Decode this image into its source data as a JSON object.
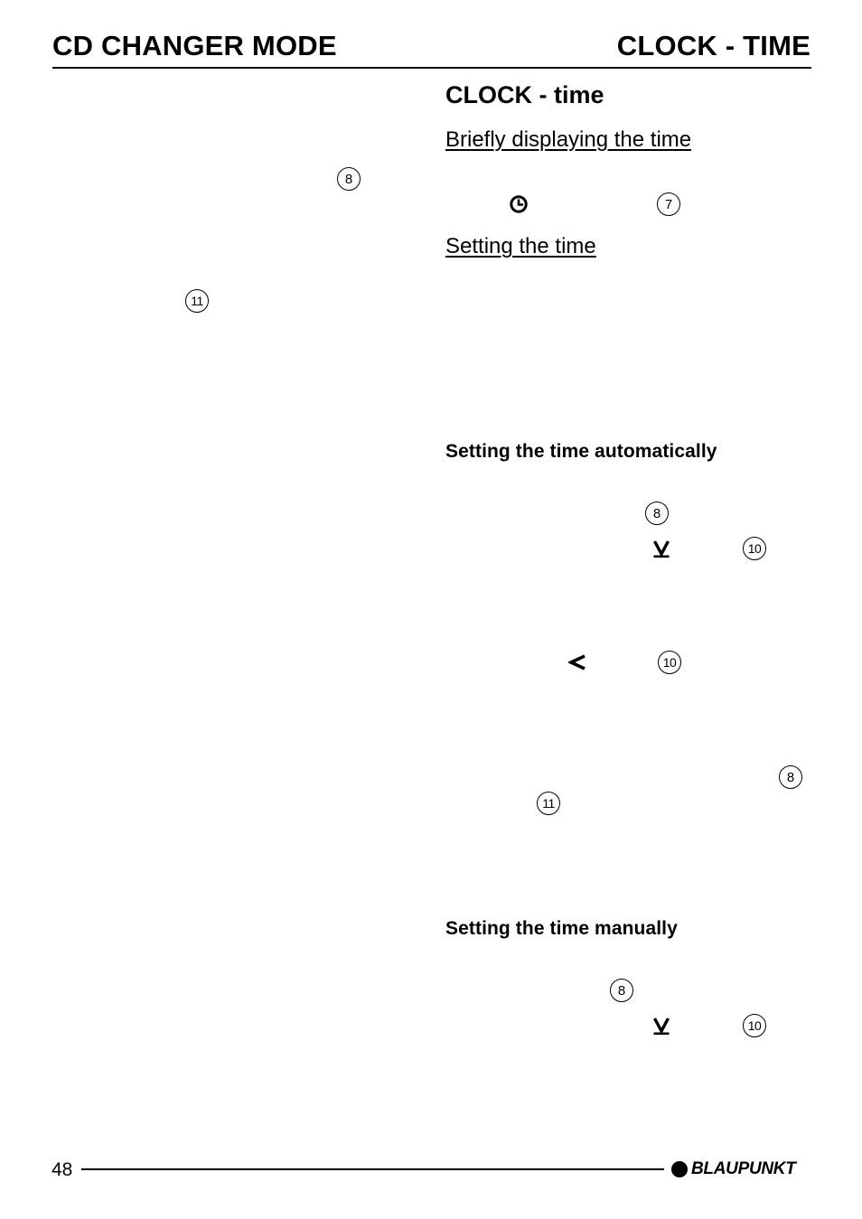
{
  "header": {
    "left_title": "CD CHANGER MODE",
    "right_title": "CLOCK - TIME"
  },
  "main": {
    "section_title": "CLOCK - time",
    "subsections": [
      {
        "title": "Briefly displaying the time",
        "style": "underlined"
      },
      {
        "title": "Setting the time",
        "style": "underlined"
      },
      {
        "title": "Setting the time automatically",
        "style": "bold"
      },
      {
        "title": "Setting the time manually",
        "style": "bold"
      }
    ]
  },
  "callouts": {
    "left_col_1": "8",
    "left_col_2": "11",
    "brief_clock_ref": "7",
    "auto_ref_1": "8",
    "auto_ref_2": "10",
    "auto_ref_3": "10",
    "auto_ref_4": "8",
    "auto_ref_5": "11",
    "manual_ref_1": "8",
    "manual_ref_2": "10"
  },
  "symbols": {
    "clock": "clock-icon",
    "down_arrow": "down-arrow-button",
    "left_arrow": "<"
  },
  "footer": {
    "page_number": "48",
    "brand": "BLAUPUNKT"
  }
}
